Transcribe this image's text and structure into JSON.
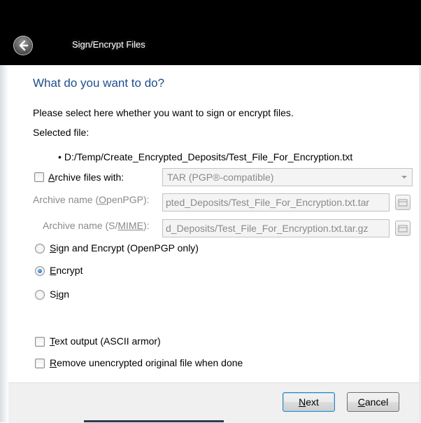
{
  "window": {
    "title": "Sign/Encrypt Files"
  },
  "heading": "What do you want to do?",
  "instruction": "Please select here whether you want to sign or encrypt files.",
  "selected_file_label": "Selected file:",
  "selected_file": {
    "bullet": "•",
    "path": "D:/Temp/Create_Encrypted_Deposits/Test_File_For_Encryption.txt"
  },
  "archive": {
    "checkbox_label_accel": "A",
    "checkbox_label_rest": "rchive files with:",
    "checked": false,
    "format_selected": "TAR (PGP®-compatible)",
    "openpgp_label_pre": "Archive name (",
    "openpgp_label_accel": "O",
    "openpgp_label_post": "penPGP):",
    "openpgp_value": "pted_Deposits/Test_File_For_Encryption.txt.tar",
    "smime_label_pre": "Archive name (S/",
    "smime_label_accel": "MIME",
    "smime_label_post": "):",
    "smime_value": "d_Deposits/Test_File_For_Encryption.txt.tar.gz"
  },
  "options": [
    {
      "accel": "S",
      "rest": "ign and Encrypt (OpenPGP only)",
      "checked": false
    },
    {
      "accel": "E",
      "rest": "ncrypt",
      "checked": true
    },
    {
      "pre": "S",
      "accel": "i",
      "rest": "gn",
      "checked": false
    }
  ],
  "text_output": {
    "accel": "T",
    "rest": "ext output (ASCII armor)",
    "checked": false
  },
  "remove_original": {
    "accel": "R",
    "rest": "emove unencrypted original file when done",
    "checked": false
  },
  "buttons": {
    "next_accel": "N",
    "next_rest": "ext",
    "cancel_accel": "C",
    "cancel_rest": "ancel"
  }
}
